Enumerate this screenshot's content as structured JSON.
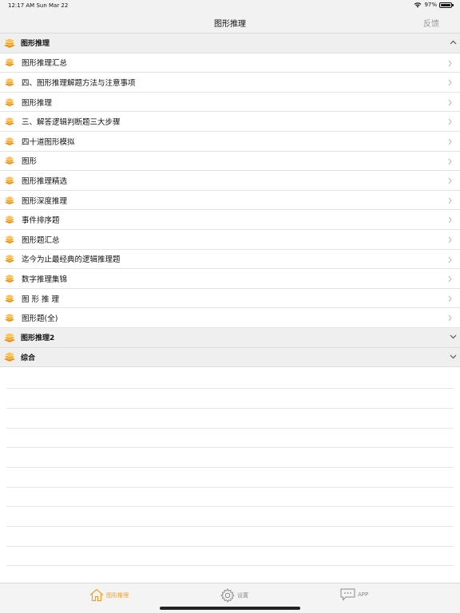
{
  "status_bar": {
    "time": "12:17 AM   Sun Mar 22",
    "battery": "97%"
  },
  "nav": {
    "title": "图形推理",
    "feedback_label": "反馈"
  },
  "sections": [
    {
      "title": "图形推理",
      "expanded": true,
      "items": [
        "图形推理汇总",
        "四、图形推理解题方法与注意事项",
        "图形推理",
        "三、解答逻辑判断题三大步骤",
        "四十道图形模拟",
        "图形",
        "图形推理精选",
        "图形深度推理",
        "事件排序题",
        "图形题汇总",
        "迄今为止最经典的逻辑推理题",
        "数字推理集锦",
        "图 形 推 理",
        "图形题(全)"
      ]
    },
    {
      "title": "图形推理2",
      "expanded": false,
      "items": []
    },
    {
      "title": "综合",
      "expanded": false,
      "items": []
    }
  ],
  "tabs": [
    {
      "label": "图形推理",
      "icon": "home-icon",
      "active": true
    },
    {
      "label": "设置",
      "icon": "gear-icon",
      "active": false
    },
    {
      "label": "APP",
      "icon": "chat-bubble-icon",
      "active": false
    }
  ],
  "colors": {
    "accent": "#f0a020",
    "icon_orange": "#f5a623",
    "inactive": "#8a8a8a"
  }
}
